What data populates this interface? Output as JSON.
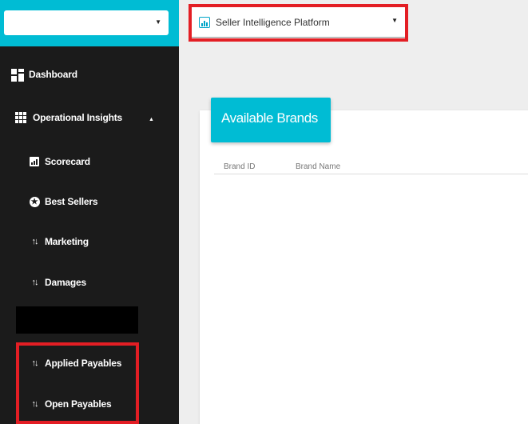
{
  "platform_select": {
    "selected": "Seller Intelligence Platform",
    "icon": "bar-chart-icon"
  },
  "sidebar": {
    "org_select_value": "",
    "items": [
      {
        "label": "Dashboard",
        "icon": "dashboard-icon"
      },
      {
        "label": "Operational Insights",
        "icon": "grid-icon",
        "expanded": true
      },
      {
        "label": "Scorecard",
        "icon": "scorecard-icon"
      },
      {
        "label": "Best Sellers",
        "icon": "star-icon"
      },
      {
        "label": "Marketing",
        "icon": "sort-icon"
      },
      {
        "label": "Damages",
        "icon": "sort-icon"
      },
      {
        "label": "Applied Payables",
        "icon": "sort-icon"
      },
      {
        "label": "Open Payables",
        "icon": "sort-icon"
      }
    ]
  },
  "brands_card": {
    "title": "Available Brands",
    "columns": [
      "Brand ID",
      "Brand Name"
    ],
    "rows": []
  },
  "colors": {
    "accent": "#00bcd4",
    "sidebar": "#1b1b1b",
    "highlight": "#e31e24"
  }
}
